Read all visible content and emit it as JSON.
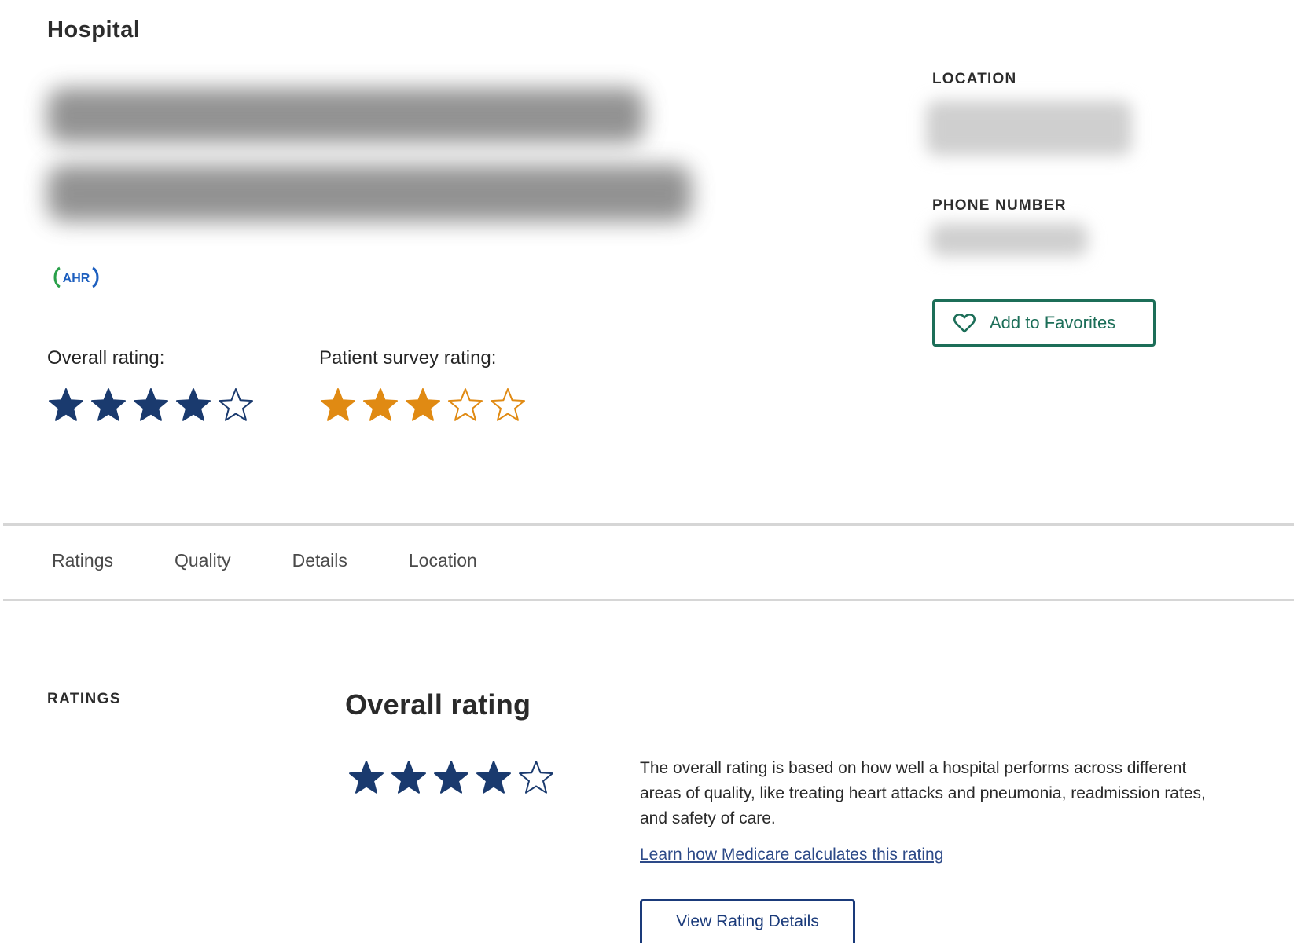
{
  "header": {
    "category_label": "Hospital"
  },
  "provider_logo": {
    "name": "ahr-logo",
    "text": "AHR"
  },
  "ratings_summary": {
    "overall": {
      "label": "Overall rating:",
      "stars": 4,
      "max": 5,
      "color": "#1a3a6e"
    },
    "patient_survey": {
      "label": "Patient survey rating:",
      "stars": 3,
      "max": 5,
      "color": "#e08a13"
    }
  },
  "sidebar": {
    "location_label": "LOCATION",
    "phone_label": "PHONE NUMBER",
    "favorite_button": {
      "label": "Add to Favorites",
      "icon": "heart-icon",
      "color": "#1c6e58"
    }
  },
  "tabs": [
    {
      "label": "Ratings"
    },
    {
      "label": "Quality"
    },
    {
      "label": "Details"
    },
    {
      "label": "Location"
    }
  ],
  "ratings_section": {
    "section_label": "RATINGS",
    "title": "Overall rating",
    "stars": 4,
    "max": 5,
    "description": "The overall rating is based on how well a hospital performs across different areas of quality, like treating heart attacks and pneumonia, readmission rates, and safety of care.",
    "learn_link": "Learn how Medicare calculates this rating",
    "view_button": "View Rating Details"
  }
}
